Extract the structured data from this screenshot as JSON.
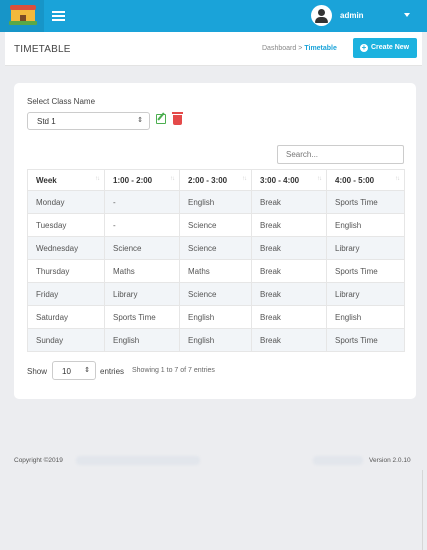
{
  "topbar": {
    "user_name": "admin",
    "accent": "#1aa3d9"
  },
  "page": {
    "title": "TIMETABLE"
  },
  "breadcrumb": {
    "parent": "Dashboard",
    "separator": ">",
    "current": "Timetable"
  },
  "create_button": {
    "label": "Create New"
  },
  "class_select": {
    "label": "Select Class Name",
    "value": "Std 1"
  },
  "search": {
    "placeholder": "Search..."
  },
  "table": {
    "headers": [
      "Week",
      "1:00 - 2:00",
      "2:00 - 3:00",
      "3:00 - 4:00",
      "4:00 - 5:00"
    ],
    "rows": [
      [
        "Monday",
        "-",
        "English",
        "Break",
        "Sports Time"
      ],
      [
        "Tuesday",
        "-",
        "Science",
        "Break",
        "English"
      ],
      [
        "Wednesday",
        "Science",
        "Science",
        "Break",
        "Library"
      ],
      [
        "Thursday",
        "Maths",
        "Maths",
        "Break",
        "Sports Time"
      ],
      [
        "Friday",
        "Library",
        "Science",
        "Break",
        "Library"
      ],
      [
        "Saturday",
        "Sports Time",
        "English",
        "Break",
        "English"
      ],
      [
        "Sunday",
        "English",
        "English",
        "Break",
        "Sports Time"
      ]
    ]
  },
  "length": {
    "show_label": "Show",
    "value": "10",
    "entries_label": "entries",
    "info": "Showing 1 to 7 of 7 entries"
  },
  "footer": {
    "copyright": "Copyright ©2019",
    "version": "Version 2.0.10"
  }
}
